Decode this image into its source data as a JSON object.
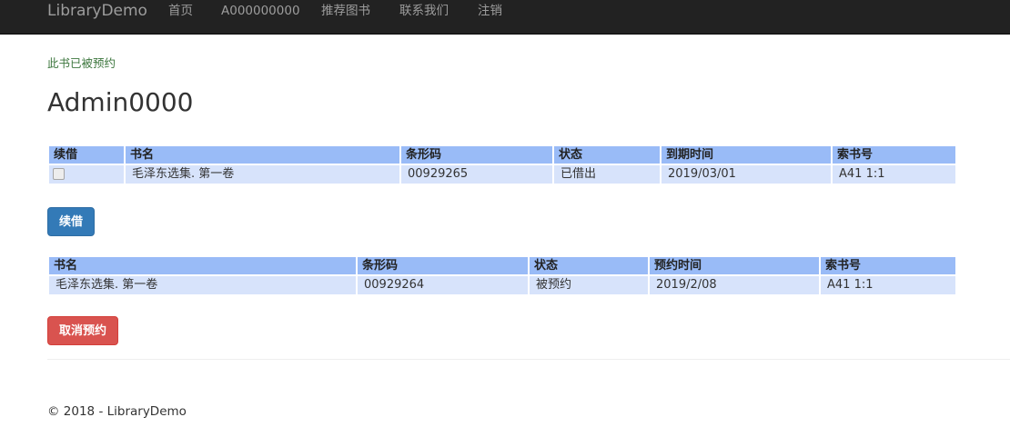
{
  "navbar": {
    "brand": "LibraryDemo",
    "items": [
      "首页",
      "A000000000",
      "推荐图书",
      "联系我们",
      "注销"
    ]
  },
  "message": "此书已被预约",
  "user": {
    "name": "Admin0000"
  },
  "borrowed": {
    "headers": [
      "续借",
      "书名",
      "条形码",
      "状态",
      "到期时间",
      "索书号"
    ],
    "rows": [
      {
        "renew_checked": false,
        "title": "毛泽东选集. 第一卷",
        "barcode": "00929265",
        "status": "已借出",
        "due": "2019/03/01",
        "call_number": "A41 1:1"
      }
    ]
  },
  "renew_button": "续借",
  "reserved": {
    "headers": [
      "书名",
      "条形码",
      "状态",
      "预约时间",
      "索书号"
    ],
    "rows": [
      {
        "title": "毛泽东选集. 第一卷",
        "barcode": "00929264",
        "status": "被预约",
        "reserved_at": "2019/2/08",
        "call_number": "A41 1:1"
      }
    ]
  },
  "cancel_button": "取消预约",
  "footer": "© 2018 - LibraryDemo"
}
